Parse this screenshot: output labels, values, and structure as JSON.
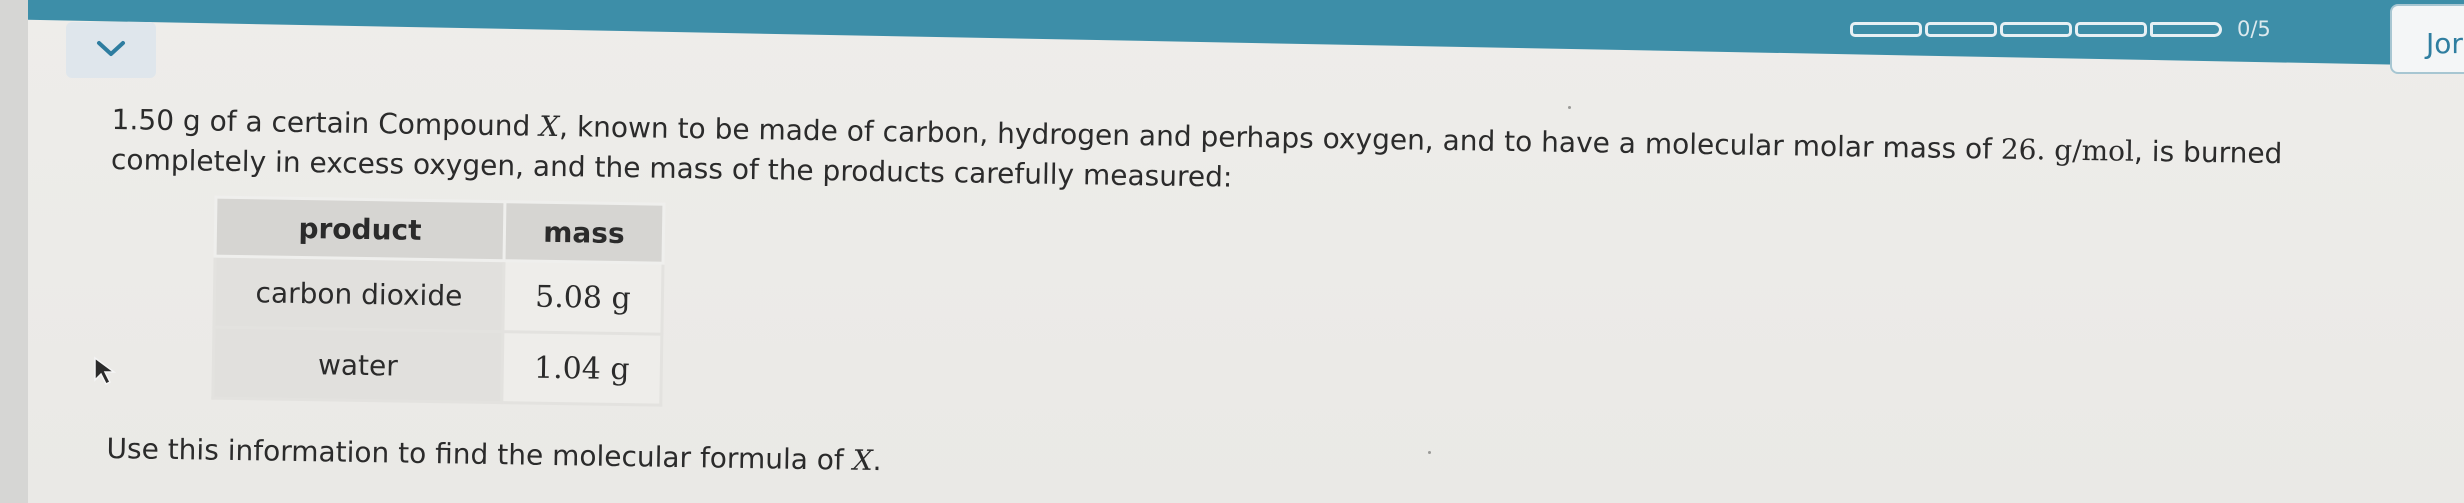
{
  "header": {
    "progress_label": "0/5",
    "progress_segments": 5,
    "progress_completed": 0,
    "user_label": "Jor",
    "bar_color": "#3d8ea8"
  },
  "question": {
    "part1": "1.50 g of a certain Compound ",
    "compound": "X",
    "part2": ", known to be made of carbon, hydrogen and perhaps oxygen, and to have a molecular molar mass of ",
    "molar_mass": "26. g/mol",
    "part3": ", is burned completely in excess oxygen, and the mass of the products carefully measured:"
  },
  "table": {
    "headers": [
      "product",
      "mass"
    ],
    "rows": [
      {
        "product": "carbon dioxide",
        "mass": "5.08 g"
      },
      {
        "product": "water",
        "mass": "1.04 g"
      }
    ]
  },
  "instruction": {
    "text": "Use this information to find the molecular formula of ",
    "compound": "X",
    "end": "."
  },
  "icons": {
    "collapse": "chevron-down-icon",
    "pointer": "mouse-pointer-icon"
  }
}
